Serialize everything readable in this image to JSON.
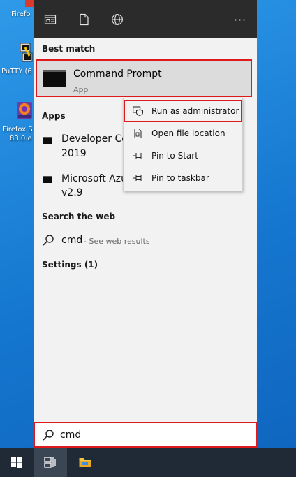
{
  "desktop": {
    "icons": [
      {
        "label": "Firefo"
      },
      {
        "label": "PuTTY (6"
      },
      {
        "label": "Firefox S",
        "label2": "83.0.e"
      }
    ]
  },
  "start_menu": {
    "more_label": "···",
    "best_match": {
      "title": "Best match",
      "name": "Command Prompt",
      "subtitle": "App"
    },
    "apps": {
      "title": "Apps",
      "items": [
        {
          "line1": "Developer Co",
          "line2": "2019"
        },
        {
          "line1": "Microsoft Azu",
          "line2": "v2.9"
        }
      ]
    },
    "search_web": {
      "title": "Search the web",
      "query": "cmd",
      "hint": "- See web results"
    },
    "settings": {
      "title": "Settings (1)"
    }
  },
  "context_menu": {
    "items": [
      {
        "label": "Run as administrator",
        "icon": "shield-icon"
      },
      {
        "label": "Open file location",
        "icon": "file-location-icon"
      },
      {
        "label": "Pin to Start",
        "icon": "pin-icon"
      },
      {
        "label": "Pin to taskbar",
        "icon": "pin-icon"
      }
    ]
  },
  "search": {
    "value": "cmd"
  },
  "colors": {
    "highlight_border": "#e01a1a",
    "tabbar_bg": "#2b2b2b",
    "taskbar_bg": "#1f2a36"
  }
}
